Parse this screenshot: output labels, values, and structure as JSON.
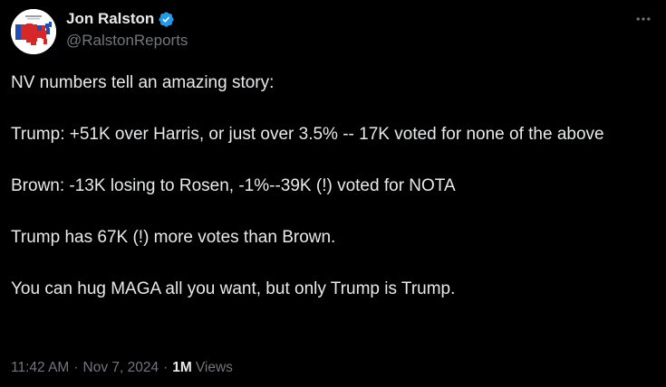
{
  "author": {
    "display_name": "Jon Ralston",
    "handle": "@RalstonReports",
    "verified": true,
    "avatar_icon": "us-election-map-avatar"
  },
  "more_icon": "more-options-icon",
  "tweet": {
    "paragraphs": [
      "NV numbers tell an amazing story:",
      "Trump: +51K over Harris, or just over 3.5% -- 17K voted for none of the above",
      "Brown: -13K losing to Rosen, -1%--39K (!) voted for NOTA",
      "Trump has 67K (!) more votes than Brown.",
      "You can hug MAGA all you want, but only Trump is Trump."
    ]
  },
  "meta": {
    "time": "11:42 AM",
    "separator": "·",
    "date": "Nov 7, 2024",
    "views_count": "1M",
    "views_label": "Views"
  },
  "colors": {
    "background": "#000000",
    "text": "#e7e9ea",
    "secondary": "#71767b",
    "verified_blue": "#1d9bf0"
  }
}
